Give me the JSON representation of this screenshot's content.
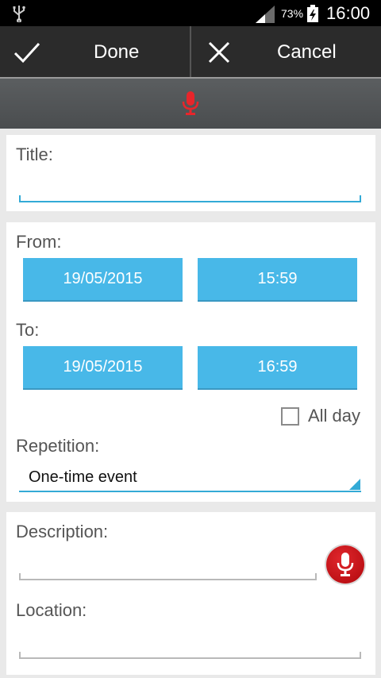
{
  "status_bar": {
    "battery_percent": "73%",
    "time": "16:00",
    "icons": [
      "usb-icon",
      "signal-icon",
      "battery-charging-icon"
    ]
  },
  "action_bar": {
    "done_label": "Done",
    "cancel_label": "Cancel",
    "done_icon": "check-icon",
    "cancel_icon": "close-icon"
  },
  "voice_bar": {
    "icon": "microphone-icon",
    "icon_color": "#e8252b"
  },
  "form": {
    "title_label": "Title:",
    "title_value": "",
    "from_label": "From:",
    "from_date": "19/05/2015",
    "from_time": "15:59",
    "to_label": "To:",
    "to_date": "19/05/2015",
    "to_time": "16:59",
    "all_day_label": "All day",
    "all_day_checked": false,
    "repetition_label": "Repetition:",
    "repetition_value": "One-time event",
    "description_label": "Description:",
    "location_label": "Location:"
  },
  "colors": {
    "accent": "#33aad6",
    "button_blue": "#48b8e8",
    "action_bar": "#2b2b2b",
    "mic_red": "#d0161c"
  }
}
